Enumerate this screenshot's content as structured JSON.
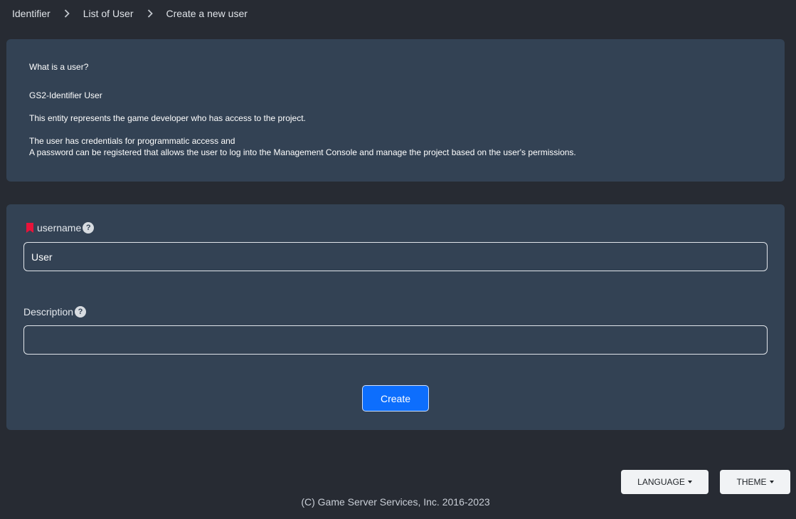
{
  "breadcrumb": {
    "items": [
      "Identifier",
      "List of User",
      "Create a new user"
    ]
  },
  "info": {
    "heading": "What is a user?",
    "title": "GS2-Identifier User",
    "line1": "This entity represents the game developer who has access to the project.",
    "line2": "The user has credentials for programmatic access and",
    "line3": "A password can be registered that allows the user to log into the Management Console and manage the project based on the user's permissions."
  },
  "form": {
    "username_label": "username",
    "username_value": "User",
    "description_label": "Description",
    "description_value": "",
    "help_glyph": "?",
    "create_label": "Create"
  },
  "footer": {
    "language_label": "LANGUAGE",
    "theme_label": "THEME",
    "copyright": "(C) Game Server Services, Inc. 2016-2023"
  },
  "colors": {
    "background": "#272b33",
    "card": "#334254",
    "primary": "#0d6efd",
    "required": "#e8133a"
  },
  "icons": {
    "breadcrumb_separator": "chevron-right-icon",
    "required": "bookmark-icon",
    "help": "question-circle-icon",
    "dropdown": "caret-down-icon"
  }
}
